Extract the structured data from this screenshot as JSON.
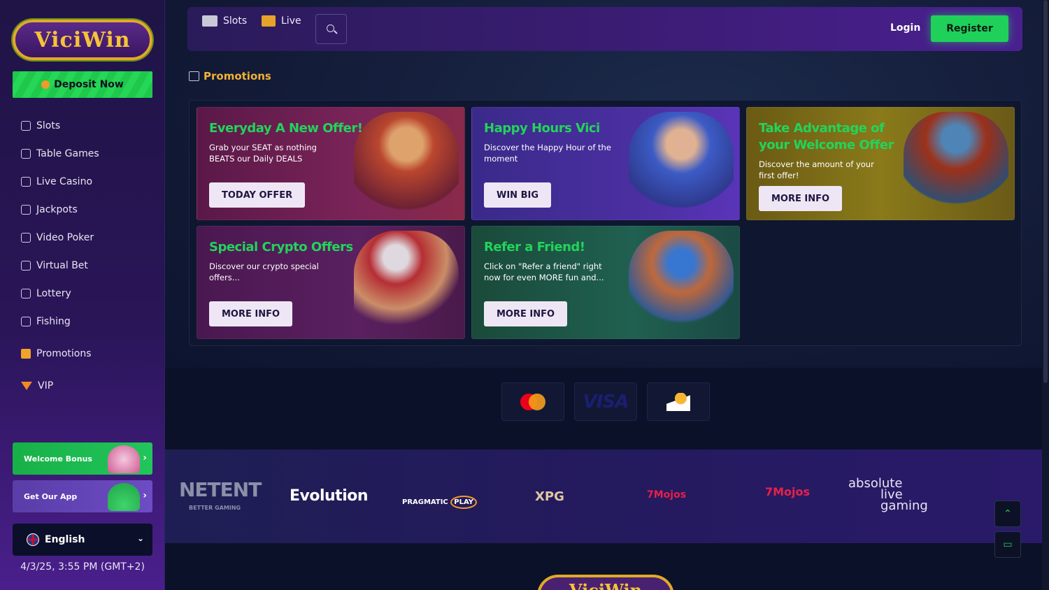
{
  "sidebar": {
    "logo_text": "ViciWin",
    "deposit_label": "Deposit Now",
    "nav": [
      {
        "label": "Slots",
        "icon": "slot-machine-icon"
      },
      {
        "label": "Table Games",
        "icon": "cards-icon"
      },
      {
        "label": "Live Casino",
        "icon": "live-casino-icon"
      },
      {
        "label": "Jackpots",
        "icon": "trophy-icon"
      },
      {
        "label": "Video Poker",
        "icon": "chip-icon"
      },
      {
        "label": "Virtual Bet",
        "icon": "virtual-bet-icon"
      },
      {
        "label": "Lottery",
        "icon": "lottery-icon"
      },
      {
        "label": "Fishing",
        "icon": "fish-icon"
      },
      {
        "label": "Promotions",
        "icon": "gift-icon"
      },
      {
        "label": "VIP",
        "icon": "diamond-icon"
      }
    ],
    "welcome_bonus": "Welcome Bonus",
    "get_app": "Get Our App",
    "language": "English",
    "datetime": "4/3/25, 3:55 PM (GMT+2)"
  },
  "topbar": {
    "slots": "Slots",
    "live": "Live",
    "login": "Login",
    "register": "Register"
  },
  "promotions": {
    "title": "Promotions",
    "cards": [
      {
        "title": "Everyday A New Offer!",
        "desc": "Grab your SEAT as nothing BEATS our Daily DEALS",
        "button": "TODAY OFFER"
      },
      {
        "title": "Happy Hours Vici",
        "desc": "Discover the Happy Hour of the moment",
        "button": "WIN BIG"
      },
      {
        "title": "Take Advantage of your Welcome Offer",
        "desc": "Discover the amount of your first offer!",
        "button": "MORE INFO"
      },
      {
        "title": "Special Crypto Offers",
        "desc": "Discover our crypto special offers...",
        "button": "MORE INFO"
      },
      {
        "title": "Refer a Friend!",
        "desc": "Click on \"Refer a friend\" right now for even MORE fun and...",
        "button": "MORE INFO"
      }
    ]
  },
  "payments": {
    "mastercard_label": "mastercard",
    "visa_label": "VISA"
  },
  "providers": {
    "netent": "NETENT",
    "netent_sub": "BETTER GAMING",
    "evolution": "Evolution",
    "pragmatic": "PRAGMATIC",
    "pragmatic_play": "PLAY",
    "xpg": "XPG",
    "mojos1": "7Mojos",
    "mojos2": "7Mojos",
    "absolute_1": "absolute",
    "absolute_2": "live",
    "absolute_3": "gaming"
  },
  "footer": {
    "logo_text": "ViciWin"
  },
  "colors": {
    "accent_green": "#1fd05a",
    "promo_gold": "#f2b233",
    "sidebar_purple": "#2a1558"
  }
}
